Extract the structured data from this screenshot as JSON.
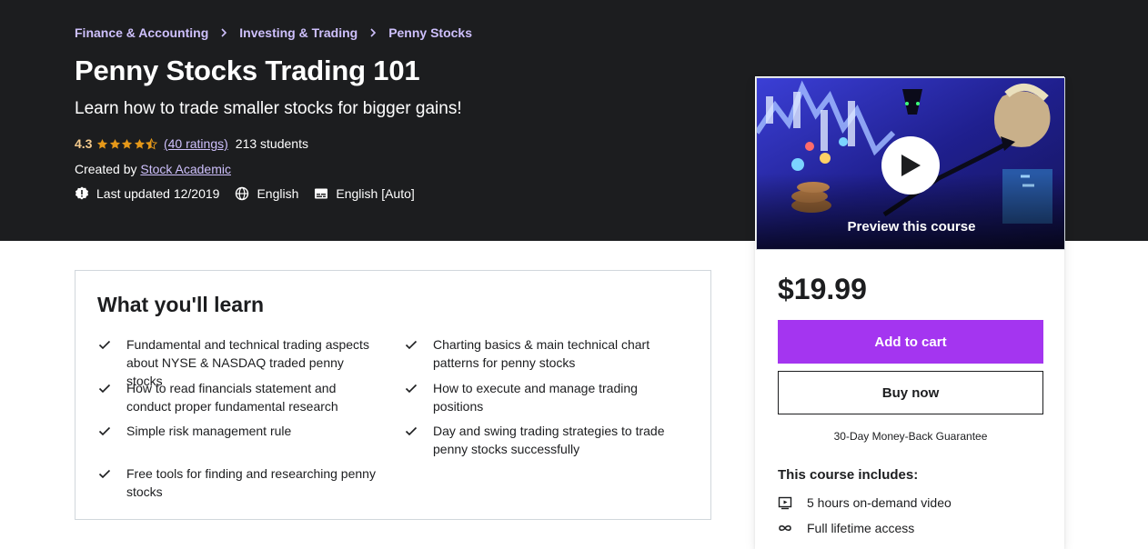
{
  "breadcrumb": [
    "Finance & Accounting",
    "Investing & Trading",
    "Penny Stocks"
  ],
  "course": {
    "title": "Penny Stocks Trading 101",
    "subtitle": "Learn how to trade smaller stocks for bigger gains!",
    "rating": "4.3",
    "rating_value": 4.3,
    "ratings_count": "(40 ratings)",
    "students": "213 students",
    "created_by_label": "Created by",
    "instructor": "Stock Academic",
    "last_updated": "Last updated 12/2019",
    "language": "English",
    "captions": "English [Auto]"
  },
  "learn": {
    "title": "What you'll learn",
    "items": [
      "Fundamental and technical trading aspects about NYSE & NASDAQ traded penny stocks",
      "Charting basics & main technical chart patterns for penny stocks",
      "How to read financials statement and conduct proper fundamental research",
      "How to execute and manage trading positions",
      "Simple risk management rule",
      "Day and swing trading strategies to trade penny stocks successfully",
      "Free tools for finding and researching penny stocks"
    ]
  },
  "sidebar": {
    "preview_label": "Preview this course",
    "price": "$19.99",
    "add_to_cart": "Add to cart",
    "buy_now": "Buy now",
    "guarantee": "30-Day Money-Back Guarantee",
    "includes_title": "This course includes:",
    "includes": [
      "5 hours on-demand video",
      "Full lifetime access"
    ]
  },
  "colors": {
    "hero_bg": "#1c1d1f",
    "link_purple": "#cec0fc",
    "rating_gold": "#f3ca8c",
    "cart_purple": "#a435f0"
  }
}
